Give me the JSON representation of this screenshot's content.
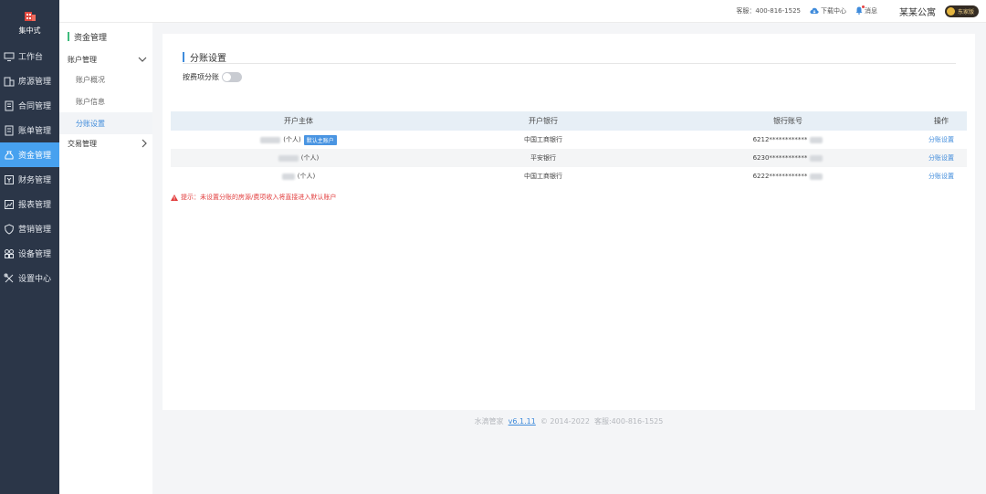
{
  "brand": {
    "name": "集中式"
  },
  "sidebar": {
    "items": [
      {
        "label": "工作台",
        "icon": "monitor-icon"
      },
      {
        "label": "房源管理",
        "icon": "building-icon"
      },
      {
        "label": "合同管理",
        "icon": "contract-icon"
      },
      {
        "label": "账单管理",
        "icon": "bill-icon"
      },
      {
        "label": "资金管理",
        "icon": "money-bag-icon",
        "active": true
      },
      {
        "label": "财务管理",
        "icon": "finance-icon"
      },
      {
        "label": "报表管理",
        "icon": "report-icon"
      },
      {
        "label": "营销管理",
        "icon": "shield-icon"
      },
      {
        "label": "设备管理",
        "icon": "device-grid-icon"
      },
      {
        "label": "设置中心",
        "icon": "tools-icon"
      }
    ]
  },
  "submenu": {
    "title": "资金管理",
    "group1": "账户管理",
    "items": [
      "账户概况",
      "账户信息",
      "分账设置"
    ],
    "group2": "交易管理"
  },
  "topbar": {
    "hotline": "客服：400-816-1525",
    "download": "下载中心",
    "messages": "消息",
    "company": "某某公寓",
    "edition": "东家版"
  },
  "main": {
    "section_title": "分账设置",
    "toggle_label": "按费项分账",
    "table": {
      "headers": [
        "开户主体",
        "开户银行",
        "银行账号",
        "操作"
      ],
      "rows": [
        {
          "owner": "(个人)",
          "tag": "默认主账户",
          "bank": "中国工商银行",
          "account": "6212************",
          "op": "分账设置"
        },
        {
          "owner": "(个人)",
          "tag": "",
          "bank": "平安银行",
          "account": "6230************",
          "op": "分账设置"
        },
        {
          "owner": "(个人)",
          "tag": "",
          "bank": "中国工商银行",
          "account": "6222************",
          "op": "分账设置"
        }
      ]
    },
    "tip": "提示：未设置分账的房源/费项收入将直接进入默认账户"
  },
  "footer": {
    "product": "水滴管家",
    "version": "v6.1.11",
    "copyright": "© 2014-2022",
    "hotline": "客服:400-816-1525"
  },
  "colors": {
    "sidebar": "#2b3648",
    "accent": "#47a1ef",
    "link": "#3f8bdb",
    "warn": "#e23d3d"
  }
}
